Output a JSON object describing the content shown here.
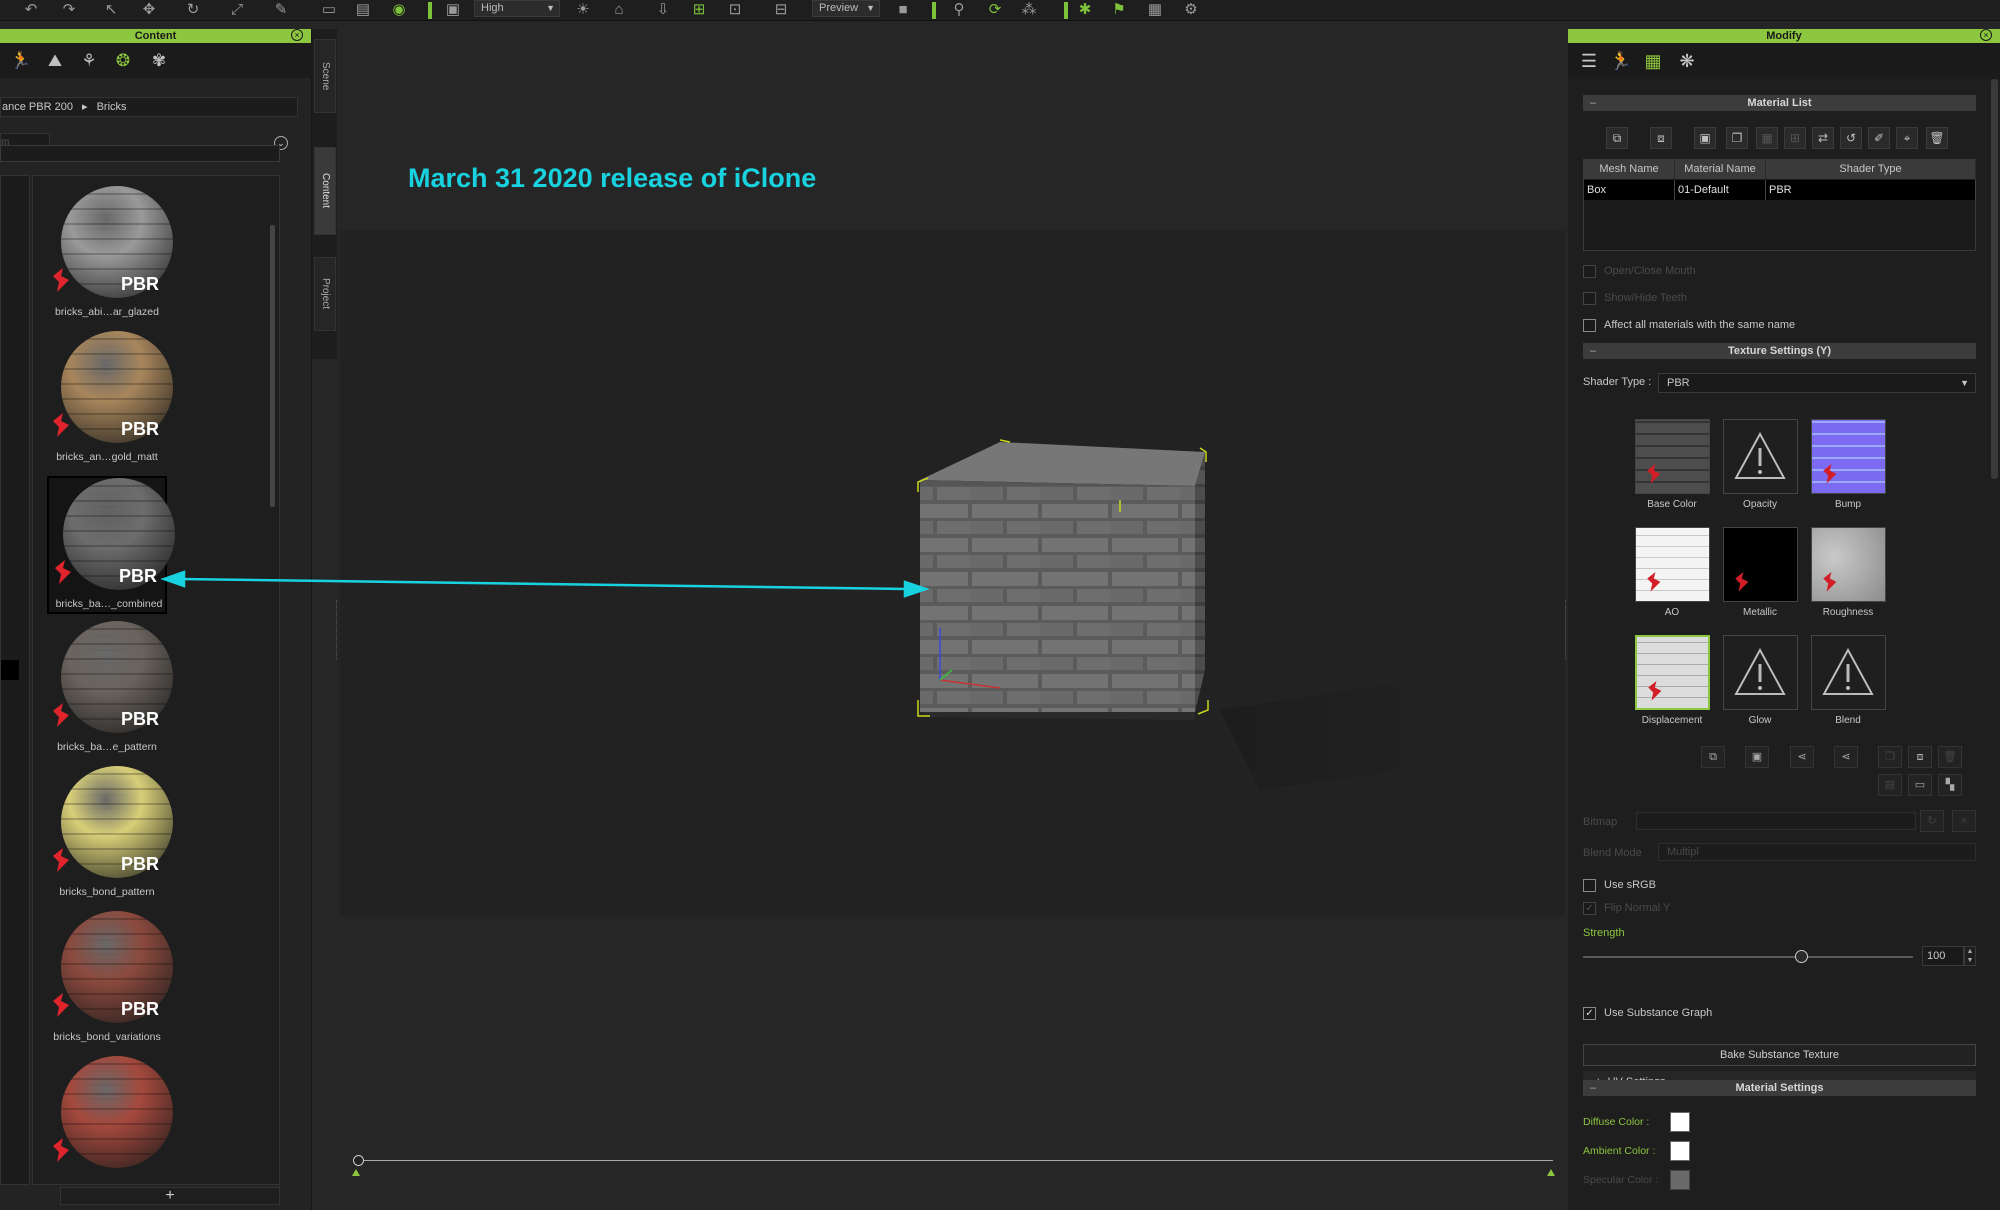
{
  "toolbar": {
    "quality_value": "High",
    "preview_value": "Preview",
    "icons": [
      "undo-icon",
      "redo-icon",
      "select-icon",
      "move-icon",
      "rotate-icon",
      "scale-icon",
      "measure-icon",
      "layout-icon",
      "save-icon",
      "visibility-icon",
      "monitor-icon",
      "sun-icon",
      "home-icon",
      "import-icon",
      "camera-add-icon",
      "snapshot-icon",
      "render-icon",
      "record-icon",
      "motion-icon",
      "physics-icon",
      "flag-icon",
      "script-icon",
      "settings-icon"
    ]
  },
  "content_panel": {
    "title": "Content",
    "breadcrumb_parent": "ance PBR 200",
    "breadcrumb_separator": "▸",
    "breadcrumb_current": "Bricks",
    "search_placeholder": "m",
    "add_label": "+",
    "side_tabs": [
      "Scene",
      "Content",
      "Project"
    ],
    "items": [
      {
        "label": "bricks_abi…ar_glazed",
        "badge": "PBR",
        "color": "#9a9a9a"
      },
      {
        "label": "bricks_an…gold_matt",
        "badge": "PBR",
        "color": "#a8865c"
      },
      {
        "label": "bricks_ba…_combined",
        "badge": "PBR",
        "color": "#6d6d6d"
      },
      {
        "label": "bricks_ba…e_pattern",
        "badge": "PBR",
        "color": "#6b645e"
      },
      {
        "label": "bricks_bond_pattern",
        "badge": "PBR",
        "color": "#d8cf78"
      },
      {
        "label": "bricks_bond_variations",
        "badge": "PBR",
        "color": "#8c4a3e"
      },
      {
        "label": "",
        "badge": "",
        "color": "#a5493d"
      }
    ]
  },
  "viewport": {
    "annotation": "March 31 2020 release of iClone",
    "annotation_color": "#19d2e0"
  },
  "modify_panel": {
    "title": "Modify",
    "material_list_title": "Material List",
    "table_headers": [
      "Mesh Name",
      "Material Name",
      "Shader Type"
    ],
    "table_row": [
      "Box",
      "01-Default",
      "PBR"
    ],
    "open_close_mouth": "Open/Close Mouth",
    "show_hide_teeth": "Show/Hide Teeth",
    "affect_all": "Affect all materials with the same name",
    "texture_settings_title": "Texture Settings  (Y)",
    "shader_type_label": "Shader Type :",
    "shader_type_value": "PBR",
    "textures": [
      {
        "label": "Base Color",
        "kind": "image"
      },
      {
        "label": "Opacity",
        "kind": "warning"
      },
      {
        "label": "Bump",
        "kind": "image"
      },
      {
        "label": "AO",
        "kind": "image"
      },
      {
        "label": "Metallic",
        "kind": "image"
      },
      {
        "label": "Roughness",
        "kind": "image"
      },
      {
        "label": "Displacement",
        "kind": "image"
      },
      {
        "label": "Glow",
        "kind": "warning"
      },
      {
        "label": "Blend",
        "kind": "warning"
      }
    ],
    "bitmap_label": "Bitmap",
    "blend_mode_label": "Blend Mode",
    "blend_mode_value": "Multipl",
    "use_srgb": "Use sRGB",
    "flip_normal": "Flip Normal Y",
    "strength_label": "Strength",
    "strength_value": "100",
    "strength_fraction": 0.66,
    "use_substance_graph": "Use Substance Graph",
    "bake_button": "Bake Substance Texture",
    "uv_settings": "UV Settings",
    "uv_toggle": "+",
    "material_settings_title": "Material Settings",
    "diffuse_color_label": "Diffuse Color :",
    "ambient_color_label": "Ambient Color :",
    "specular_color_label": "Specular Color :",
    "diffuse_color": "#ffffff",
    "ambient_color": "#ffffff",
    "specular_color": "#6a6a6a"
  },
  "colors": {
    "accent": "#8dc63f",
    "annotation_arrow": "#19d2e0"
  }
}
